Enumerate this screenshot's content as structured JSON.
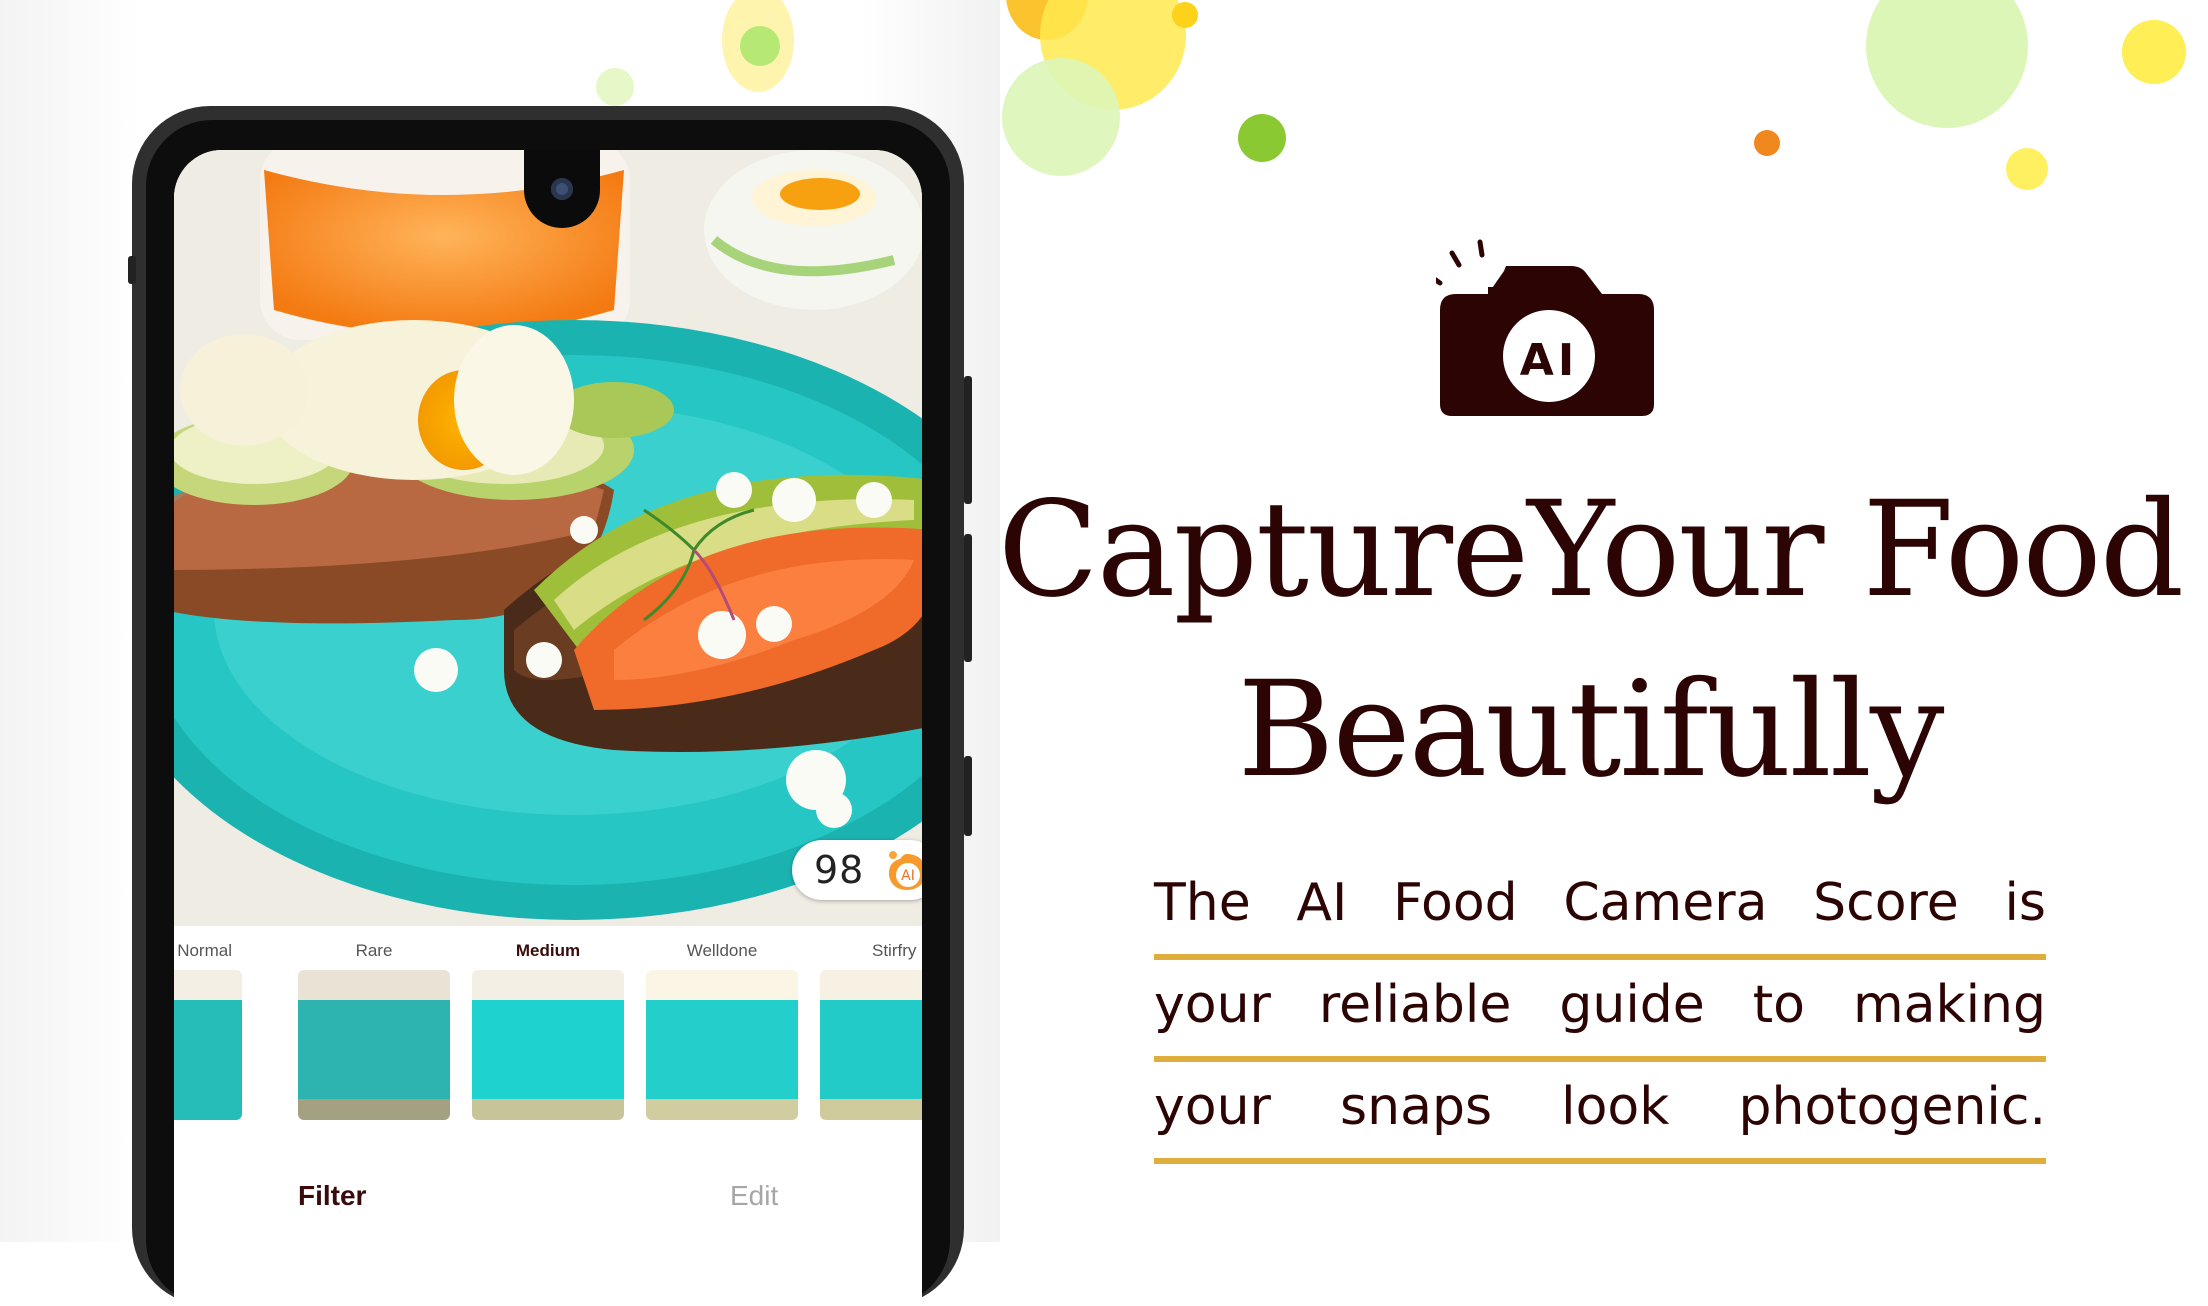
{
  "phone": {
    "photo": {
      "description": "Open-faced toasts with soft-boiled egg, avocado, smoked salmon and feta on a turquoise plate",
      "score": "98",
      "score_badge_icon": "ai-score-icon",
      "score_badge_icon_label": "AI"
    },
    "filters": [
      {
        "label": "Normal",
        "active": false
      },
      {
        "label": "Rare",
        "active": false
      },
      {
        "label": "Medium",
        "active": true
      },
      {
        "label": "Welldone",
        "active": false
      },
      {
        "label": "Stirfry",
        "active": false
      }
    ],
    "tabs": [
      {
        "label": "Filter",
        "active": true
      },
      {
        "label": "Edit",
        "active": false
      }
    ]
  },
  "promo": {
    "camera_icon": "ai-camera-icon",
    "camera_icon_label": "AI",
    "headline_line1": "CaptureYour Food",
    "headline_line2": "Beautifully",
    "body_lines": [
      "The AI Food Camera Score is",
      "your reliable guide to making",
      "your snaps look photogenic."
    ]
  },
  "colors": {
    "text_dark": "#2d0404",
    "underline_gold": "#e0ae3c",
    "badge_orange": "#f28c28",
    "plate_turquoise": "#23c3c3"
  }
}
